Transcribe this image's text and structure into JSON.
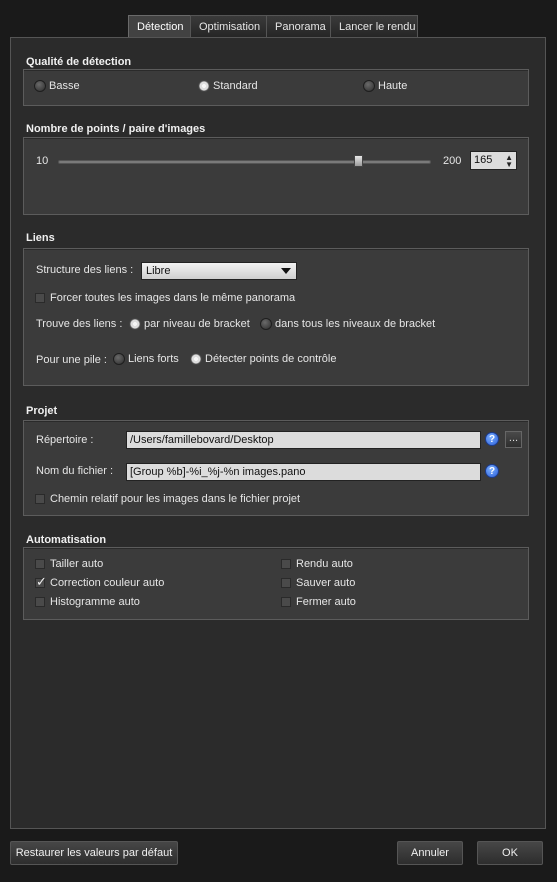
{
  "tabs": [
    "Détection",
    "Optimisation",
    "Panorama",
    "Lancer le rendu"
  ],
  "detection_quality": {
    "title": "Qualité de détection",
    "options": [
      "Basse",
      "Standard",
      "Haute"
    ],
    "selected": "Standard"
  },
  "points": {
    "title": "Nombre de points / paire d'images",
    "min_label": "10",
    "max_label": "200",
    "value": "165",
    "slider_fraction": 0.816
  },
  "links": {
    "title": "Liens",
    "structure_label": "Structure des liens :",
    "structure_value": "Libre",
    "force_label": "Forcer toutes les images dans le même panorama",
    "find_label": "Trouve des liens :",
    "find_options": [
      "par niveau de bracket",
      "dans tous les niveaux de bracket"
    ],
    "find_selected": "par niveau de bracket",
    "stack_label": "Pour une pile :",
    "stack_options": [
      "Liens forts",
      "Détecter points de contrôle"
    ],
    "stack_selected": "Détecter points de contrôle"
  },
  "project": {
    "title": "Projet",
    "dir_label": "Répertoire :",
    "dir_value": "/Users/famillebovard/Desktop",
    "file_label": "Nom du fichier :",
    "file_value": "[Group %b]-%i_%j-%n images.pano",
    "relative_label": "Chemin relatif pour les images dans le fichier projet",
    "help_glyph": "?",
    "browse_label": "..."
  },
  "automation": {
    "title": "Automatisation",
    "left": [
      {
        "label": "Tailler auto",
        "checked": false
      },
      {
        "label": "Correction couleur auto",
        "checked": true
      },
      {
        "label": "Histogramme auto",
        "checked": false
      }
    ],
    "right": [
      {
        "label": "Rendu auto",
        "checked": false
      },
      {
        "label": "Sauver auto",
        "checked": false
      },
      {
        "label": "Fermer auto",
        "checked": false
      }
    ]
  },
  "buttons": {
    "restore": "Restaurer les valeurs par défaut",
    "cancel": "Annuler",
    "ok": "OK"
  },
  "icons": {
    "help": "help-icon",
    "check_glyph": "✓"
  }
}
